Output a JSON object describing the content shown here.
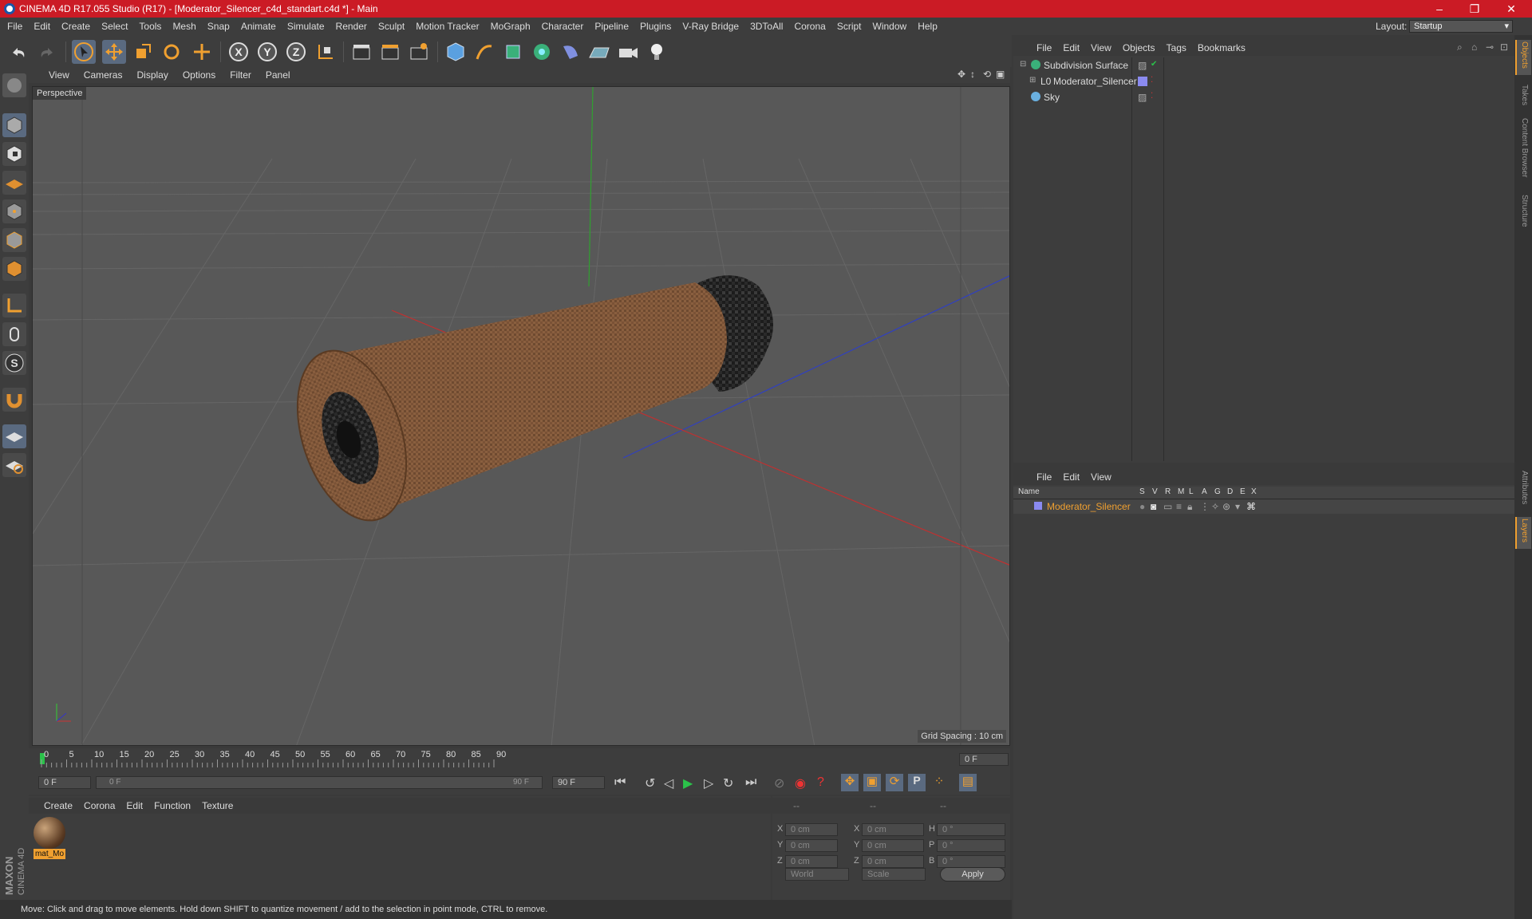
{
  "window": {
    "title": "CINEMA 4D R17.055 Studio (R17) - [Moderator_Silencer_c4d_standart.c4d *] - Main",
    "minimize": "–",
    "maximize": "❐",
    "close": "✕"
  },
  "menu": [
    "File",
    "Edit",
    "Create",
    "Select",
    "Tools",
    "Mesh",
    "Snap",
    "Animate",
    "Simulate",
    "Render",
    "Sculpt",
    "Motion Tracker",
    "MoGraph",
    "Character",
    "Pipeline",
    "Plugins",
    "V-Ray Bridge",
    "3DToAll",
    "Corona",
    "Script",
    "Window",
    "Help"
  ],
  "layout": {
    "label": "Layout:",
    "value": "Startup"
  },
  "viewport": {
    "menu": [
      "View",
      "Cameras",
      "Display",
      "Options",
      "Filter",
      "Panel"
    ],
    "name": "Perspective",
    "grid_spacing": "Grid Spacing : 10 cm"
  },
  "timeline": {
    "ticks": [
      "0",
      "5",
      "10",
      "15",
      "20",
      "25",
      "30",
      "35",
      "40",
      "45",
      "50",
      "55",
      "60",
      "65",
      "70",
      "75",
      "80",
      "85",
      "90"
    ],
    "frame_end": "0 F"
  },
  "transport": {
    "current": "0 F",
    "slider_start": "0 F",
    "slider_end": "90 F",
    "end": "90 F"
  },
  "material_manager": {
    "menu": [
      "Create",
      "Corona",
      "Edit",
      "Function",
      "Texture"
    ],
    "materials": [
      {
        "name": "mat_Mo"
      }
    ]
  },
  "coordinates": {
    "headers": [
      "--",
      "--",
      "--"
    ],
    "rows": [
      {
        "a": "X",
        "av": "0 cm",
        "b": "X",
        "bv": "0 cm",
        "c": "H",
        "cv": "0 °"
      },
      {
        "a": "Y",
        "av": "0 cm",
        "b": "Y",
        "bv": "0 cm",
        "c": "P",
        "cv": "0 °"
      },
      {
        "a": "Z",
        "av": "0 cm",
        "b": "Z",
        "bv": "0 cm",
        "c": "B",
        "cv": "0 °"
      }
    ],
    "mode1": "World",
    "mode2": "Scale",
    "apply": "Apply"
  },
  "object_manager": {
    "menu": [
      "File",
      "Edit",
      "View",
      "Objects",
      "Tags",
      "Bookmarks"
    ],
    "objects": [
      {
        "name": "Subdivision Surface"
      },
      {
        "name": "Moderator_Silencer"
      },
      {
        "name": "Sky"
      }
    ]
  },
  "layer_manager": {
    "menu": [
      "File",
      "Edit",
      "View"
    ],
    "columns": [
      "Name",
      "S",
      "V",
      "R",
      "M",
      "L",
      "A",
      "G",
      "D",
      "E",
      "X"
    ],
    "layers": [
      {
        "name": "Moderator_Silencer",
        "color": "#8a8af0"
      }
    ]
  },
  "side_tabs": [
    "Objects",
    "Takes",
    "Content Browser",
    "Structure"
  ],
  "side_tabs2": [
    "Attributes",
    "Layers"
  ],
  "status": "Move: Click and drag to move elements. Hold down SHIFT to quantize movement / add to the selection in point mode, CTRL to remove.",
  "brand": "MAXON CINEMA 4D",
  "colors": {
    "title_bg": "#cb1b25",
    "accent": "#f0a030",
    "layer_text": "#f0a030"
  }
}
